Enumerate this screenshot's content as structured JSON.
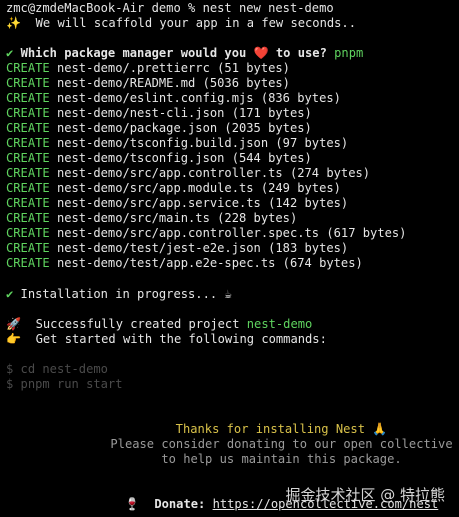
{
  "prompt_line": "zmc@zmdeMacBook-Air demo % nest new nest-demo",
  "scaffold_line": {
    "icon": "sparkles-icon",
    "glyph": "✨",
    "text": "  We will scaffold your app in a few seconds.."
  },
  "question": {
    "check_glyph": "✔",
    "text_before": "Which package manager would you ",
    "heart_glyph": "❤️",
    "text_after": " to use?",
    "answer": "pnpm"
  },
  "create_label": "CREATE",
  "created_files": [
    "nest-demo/.prettierrc (51 bytes)",
    "nest-demo/README.md (5036 bytes)",
    "nest-demo/eslint.config.mjs (836 bytes)",
    "nest-demo/nest-cli.json (171 bytes)",
    "nest-demo/package.json (2035 bytes)",
    "nest-demo/tsconfig.build.json (97 bytes)",
    "nest-demo/tsconfig.json (544 bytes)",
    "nest-demo/src/app.controller.ts (274 bytes)",
    "nest-demo/src/app.module.ts (249 bytes)",
    "nest-demo/src/app.service.ts (142 bytes)",
    "nest-demo/src/main.ts (228 bytes)",
    "nest-demo/src/app.controller.spec.ts (617 bytes)",
    "nest-demo/test/jest-e2e.json (183 bytes)",
    "nest-demo/test/app.e2e-spec.ts (674 bytes)"
  ],
  "install": {
    "check_glyph": "✔",
    "text": " Installation in progress... ",
    "coffee_glyph": "☕"
  },
  "success": {
    "rocket_glyph": "🚀",
    "text": "  Successfully created project ",
    "project": "nest-demo"
  },
  "get_started": {
    "hand_glyph": "👉",
    "text": "  Get started with the following commands:"
  },
  "commands": [
    "$ cd nest-demo",
    "$ pnpm run start"
  ],
  "thanks": {
    "text": "Thanks for installing Nest ",
    "pray_glyph": "🙏"
  },
  "donate_lines": [
    "Please consider donating to our open collective",
    "to help us maintain this package."
  ],
  "donate": {
    "wine_glyph": "🍷",
    "label": "Donate:",
    "url": "https://opencollective.com/nest"
  },
  "watermark": "掘金技术社区 @ 特拉熊",
  "colors": {
    "green": "#5fd35f",
    "yellow": "#d9c24a",
    "gray": "#9a9a9a",
    "dim": "#4a4a4a",
    "background": "#000000"
  }
}
